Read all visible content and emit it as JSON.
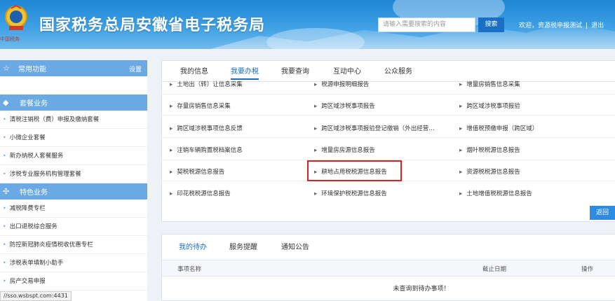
{
  "header": {
    "emblem_text": "中国税务",
    "title": "国家税务总局安徽省电子税务局",
    "search_placeholder": "请输入需要搜索的内容",
    "search_button": "搜索",
    "welcome": "欢迎，资源税申报测试",
    "separator": "|",
    "logout": "退出"
  },
  "sidebar": {
    "common": {
      "label": "常用功能",
      "settings": "设置"
    },
    "categories": [
      {
        "label": "套餐业务",
        "items": [
          "清税注销税（费）申报及缴纳套餐",
          "小微企业套餐",
          "新办纳税人套餐服务",
          "涉税专业服务机构管理套餐"
        ]
      },
      {
        "label": "特色业务",
        "items": [
          "减税降费专栏",
          "出口退税综合服务",
          "防控新冠肺炎疫情税收优惠专栏",
          "涉税表单填制小助手",
          "房产交易申报"
        ]
      }
    ]
  },
  "status_url": "//sso.wsbspt.com:4431",
  "main_tabs": [
    "我的信息",
    "我要办税",
    "我要查询",
    "互动中心",
    "公众服务"
  ],
  "active_main_tab": "我要办税",
  "tax_items": [
    [
      "土地出（转）让信息采集",
      "税源申报明细报告",
      "增量房销售信息采集"
    ],
    [
      "存量房销售信息采集",
      "跨区域涉税事项报告",
      "跨区域涉税事项报验"
    ],
    [
      "跨区域涉税事项信息反馈",
      "跨区域涉税事项报验登记缴销（外出经营…",
      "增值税预缴申报（跨区域）"
    ],
    [
      "注销车辆购置税档案信息",
      "增量房房源信息报告",
      "烟叶税税源信息报告"
    ],
    [
      "契税税源信息报告",
      "耕地占用税税源信息报告",
      "资源税税源信息报告"
    ],
    [
      "印花税税源信息报告",
      "环境保护税税源信息报告",
      "土地增值税税源信息报告"
    ]
  ],
  "back_button": "返回",
  "bottom_tabs": [
    "我的待办",
    "服务提醒",
    "通知公告"
  ],
  "active_bottom_tab": "我的待办",
  "table": {
    "col_item": "事项名称",
    "col_deadline": "截止日期",
    "col_action": "操作",
    "empty": "未查询到待办事项！"
  }
}
